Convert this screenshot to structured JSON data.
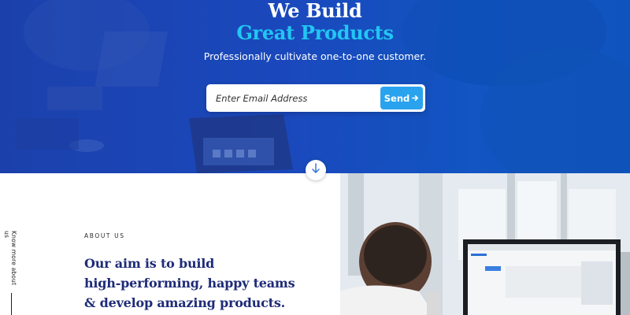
{
  "hero": {
    "title_line1": "We Build",
    "title_line2": "Great Products",
    "subtitle": "Professionally cultivate one-to-one customer.",
    "email_placeholder": "Enter Email Address",
    "send_label": "Send",
    "send_icon": "arrow-right-icon",
    "scroll_icon": "arrow-down-icon",
    "accent_color": "#22c6f2",
    "overlay_color": "#1b4bc0"
  },
  "about": {
    "side_label": "Know more about us",
    "eyebrow": "ABOUT US",
    "heading_line1": "Our aim is to build",
    "heading_line2": "high-performing, happy teams",
    "heading_line3": "& develop amazing products.",
    "heading_color": "#1e2b78"
  }
}
